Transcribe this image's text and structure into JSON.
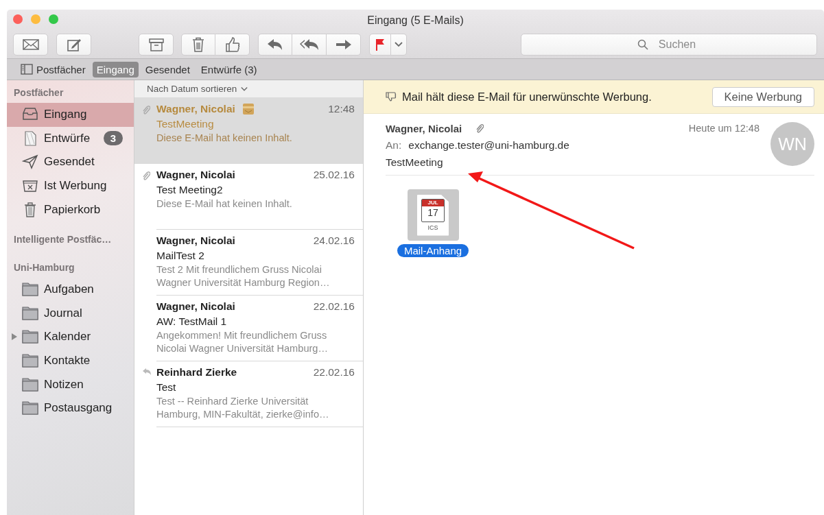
{
  "window": {
    "title": "Eingang (5 E-Mails)"
  },
  "search": {
    "placeholder": "Suchen"
  },
  "favorites_bar": [
    {
      "label": "Postfächer",
      "kind": "toggle",
      "selected": false
    },
    {
      "label": "Eingang",
      "kind": "mailbox",
      "selected": true
    },
    {
      "label": "Gesendet",
      "kind": "mailbox",
      "selected": false
    },
    {
      "label": "Entwürfe (3)",
      "kind": "mailbox",
      "selected": false
    }
  ],
  "sidebar": {
    "sections": [
      {
        "title": "Postfächer",
        "items": [
          {
            "label": "Eingang",
            "kind": "inbox",
            "selected": true,
            "expandable": false
          },
          {
            "label": "Entwürfe",
            "kind": "drafts",
            "badge": "3",
            "selected": false,
            "expandable": false
          },
          {
            "label": "Gesendet",
            "kind": "sent",
            "selected": false,
            "expandable": false
          },
          {
            "label": "Ist Werbung",
            "kind": "junk",
            "selected": false,
            "expandable": false
          },
          {
            "label": "Papierkorb",
            "kind": "trash",
            "selected": false,
            "expandable": false
          }
        ]
      },
      {
        "title": "Intelligente Postfäc…"
      },
      {
        "title": "Uni-Hamburg",
        "items": [
          {
            "label": "Aufgaben",
            "kind": "folder",
            "selected": false,
            "expandable": false
          },
          {
            "label": "Journal",
            "kind": "folder",
            "selected": false,
            "expandable": false
          },
          {
            "label": "Kalender",
            "kind": "folder",
            "selected": false,
            "expandable": true
          },
          {
            "label": "Kontakte",
            "kind": "folder",
            "selected": false,
            "expandable": false
          },
          {
            "label": "Notizen",
            "kind": "folder",
            "selected": false,
            "expandable": false
          },
          {
            "label": "Postausgang",
            "kind": "folder",
            "selected": false,
            "expandable": false
          }
        ]
      }
    ]
  },
  "message_list": {
    "sort_label": "Nach Datum sortieren",
    "items": [
      {
        "sender": "Wagner, Nicolai",
        "date": "12:48",
        "subject": "TestMeeting",
        "preview": [
          "Diese E-Mail hat keinen Inhalt."
        ],
        "has_attachment": true,
        "replied": false,
        "junk": true,
        "selected": true
      },
      {
        "sender": "Wagner, Nicolai",
        "date": "25.02.16",
        "subject": "Test Meeting2",
        "preview": [
          "Diese E-Mail hat keinen Inhalt."
        ],
        "has_attachment": true,
        "replied": false,
        "junk": false,
        "selected": false
      },
      {
        "sender": "Wagner, Nicolai",
        "date": "24.02.16",
        "subject": "MailTest 2",
        "preview": [
          "Test 2 Mit freundlichem Gruss Nicolai",
          "Wagner Universität Hamburg Region…"
        ],
        "has_attachment": false,
        "replied": false,
        "junk": false,
        "selected": false
      },
      {
        "sender": "Wagner, Nicolai",
        "date": "22.02.16",
        "subject": "AW: TestMail 1",
        "preview": [
          "Angekommen! Mit freundlichem Gruss",
          "Nicolai Wagner Universität Hamburg…"
        ],
        "has_attachment": false,
        "replied": false,
        "junk": false,
        "selected": false
      },
      {
        "sender": "Reinhard Zierke",
        "date": "22.02.16",
        "subject": "Test",
        "preview": [
          "Test -- Reinhard Zierke Universität",
          "Hamburg, MIN-Fakultät, zierke@info…"
        ],
        "has_attachment": false,
        "replied": true,
        "junk": false,
        "selected": false
      }
    ]
  },
  "viewer": {
    "banner": {
      "text": "Mail hält diese E-Mail für unerwünschte Werbung.",
      "button": "Keine Werbung"
    },
    "header": {
      "sender": "Wagner, Nicolai",
      "has_attachment": true,
      "date": "Heute um 12:48",
      "to_label": "An:",
      "to": "exchange.tester@uni-hamburg.de",
      "subject": "TestMeeting",
      "avatar": "WN"
    },
    "attachments": [
      {
        "name": "Mail-Anhang",
        "type": "ICS",
        "month": "JUL",
        "day": "17",
        "selected": true
      }
    ]
  },
  "annotations": [
    {
      "kind": "arrow"
    }
  ]
}
